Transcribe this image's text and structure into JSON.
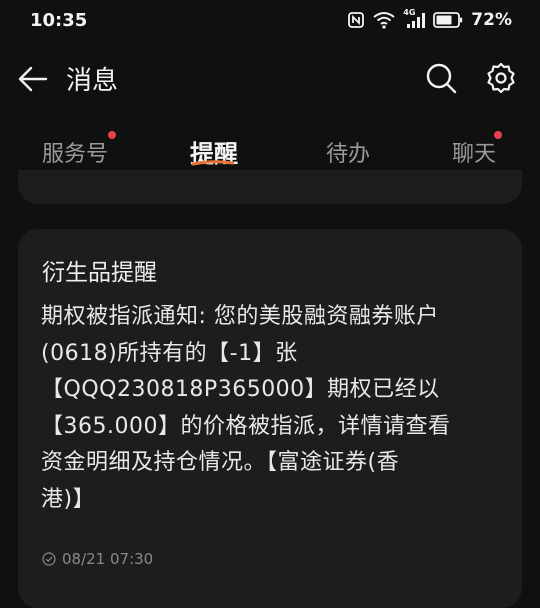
{
  "status_bar": {
    "time": "10:35",
    "network_label": "4G",
    "battery": "72%"
  },
  "header": {
    "title": "消息",
    "back_icon": "arrow-left-icon",
    "search_icon": "search-icon",
    "settings_icon": "gear-icon"
  },
  "tabs": [
    {
      "label": "服务号",
      "has_badge": true
    },
    {
      "label": "提醒",
      "active": true
    },
    {
      "label": "待办",
      "has_badge": false
    },
    {
      "label": "聊天",
      "has_badge": true
    }
  ],
  "colors": {
    "background": "#101010",
    "card": "#1d1d1d",
    "badge": "#e8414b",
    "tab_underline": "#e8743b"
  },
  "message_card": {
    "title": "衍生品提醒",
    "body_lines": [
      "期权被指派通知: 您的美股融资融券账户",
      "(0618)所持有的【-1】张",
      "【QQQ230818P365000】期权已经以",
      "【365.000】的价格被指派，详情请查看",
      "资金明细及持仓情况。【富途证券(香",
      "港)】"
    ],
    "timestamp": "08/21 07:30"
  }
}
